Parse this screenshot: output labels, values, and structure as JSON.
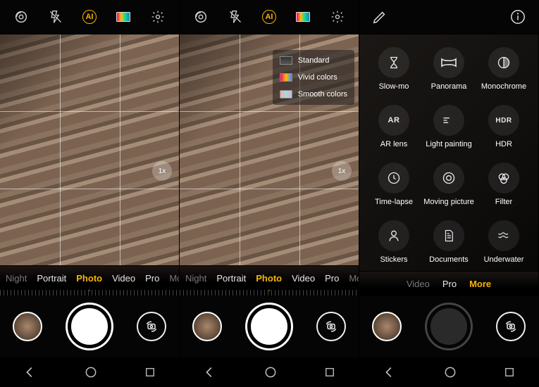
{
  "phone1": {
    "zoom": "1x",
    "modes": [
      "Night",
      "Portrait",
      "Photo",
      "Video",
      "Pro",
      "Mo"
    ],
    "active_mode": "Photo"
  },
  "phone2": {
    "zoom": "1x",
    "modes": [
      "Night",
      "Portrait",
      "Photo",
      "Video",
      "Pro",
      "Mo"
    ],
    "active_mode": "Photo",
    "filters": [
      {
        "label": "Standard",
        "swatch": "std"
      },
      {
        "label": "Vivid colors",
        "swatch": "viv"
      },
      {
        "label": "Smooth colors",
        "swatch": "smo"
      }
    ]
  },
  "phone3": {
    "modes_visible": [
      "Video",
      "Pro",
      "More"
    ],
    "active_mode": "More",
    "grid_modes": [
      {
        "label": "Slow-mo",
        "icon": "hourglass"
      },
      {
        "label": "Panorama",
        "icon": "panorama"
      },
      {
        "label": "Monochrome",
        "icon": "mono"
      },
      {
        "label": "AR lens",
        "icon": "ar"
      },
      {
        "label": "Light painting",
        "icon": "lightpaint"
      },
      {
        "label": "HDR",
        "icon": "hdr"
      },
      {
        "label": "Time-lapse",
        "icon": "timelapse"
      },
      {
        "label": "Moving picture",
        "icon": "moving"
      },
      {
        "label": "Filter",
        "icon": "filter"
      },
      {
        "label": "Stickers",
        "icon": "stickers"
      },
      {
        "label": "Documents",
        "icon": "documents"
      },
      {
        "label": "Underwater",
        "icon": "underwater"
      },
      {
        "label": "",
        "icon": "flower"
      },
      {
        "label": "",
        "icon": "download"
      }
    ]
  },
  "icon_svg": {
    "lens": "<svg width='22' height='22' viewBox='0 0 24 24' fill='none' stroke='currentColor' stroke-width='1.6'><circle cx='12' cy='12' r='8'/><circle cx='12' cy='12' r='3'/><path d='M5 12a7 7 0 0 1 7-7'/></svg>",
    "flash-off": "<svg width='20' height='20' viewBox='0 0 24 24' fill='none' stroke='currentColor' stroke-width='1.6'><path d='M7 2l-2 11h5l-1 9 8-13h-5l2-7z'/><line x1='3' y1='3' x2='21' y2='21'/></svg>",
    "gear": "<svg width='20' height='20' viewBox='0 0 24 24' fill='none' stroke='currentColor' stroke-width='1.6'><circle cx='12' cy='12' r='3'/><path d='M12 2v3M12 19v3M4.2 4.2l2.1 2.1M17.7 17.7l2.1 2.1M2 12h3M19 12h3M4.2 19.8l2.1-2.1M17.7 6.3l2.1-2.1'/></svg>",
    "edit": "<svg width='22' height='22' viewBox='0 0 24 24' fill='none' stroke='currentColor' stroke-width='1.6'><path d='M3 21l4-1 12-12-3-3L4 17z'/></svg>",
    "info": "<svg width='22' height='22' viewBox='0 0 24 24' fill='none' stroke='currentColor' stroke-width='1.6'><circle cx='12' cy='12' r='10'/><line x1='12' y1='10' x2='12' y2='17'/><circle cx='12' cy='7' r='0.5' fill='currentColor'/></svg>",
    "switch": "<svg width='20' height='20' viewBox='0 0 24 24' fill='none' stroke='currentColor' stroke-width='1.8'><rect x='6' y='8' width='12' height='8' rx='2'/><circle cx='12' cy='12' r='2'/><path d='M4 8a8 8 0 0 1 8-4M20 16a8 8 0 0 1-8 4'/></svg>",
    "back": "<svg width='22' height='22' viewBox='0 0 24 24' fill='none' stroke='currentColor' stroke-width='1.8'><path d='M14 5l-7 7 7 7'/></svg>",
    "home": "<svg width='20' height='20' viewBox='0 0 24 24' fill='none' stroke='currentColor' stroke-width='1.8'><circle cx='12' cy='12' r='8'/></svg>",
    "recent": "<svg width='18' height='18' viewBox='0 0 24 24' fill='none' stroke='currentColor' stroke-width='1.8'><rect x='5' y='5' width='14' height='14'/></svg>",
    "hourglass": "<svg width='20' height='20' viewBox='0 0 24 24' fill='none' stroke='currentColor' stroke-width='1.6'><path d='M6 3h12M6 21h12M7 3c0 5 5 5 5 9s-5 4-5 9M17 3c0 5-5 5-5 9s5 4 5 9'/></svg>",
    "panorama": "<svg width='24' height='16' viewBox='0 0 24 16' fill='none' stroke='currentColor' stroke-width='1.6'><path d='M2 3c4 3 16 3 20 0v10c-4-3-16-3-20 0z'/></svg>",
    "mono": "<svg width='20' height='20' viewBox='0 0 24 24' fill='none' stroke='currentColor' stroke-width='1.6'><circle cx='12' cy='12' r='9'/><path d='M12 3v18' /><path d='M12 3a9 9 0 0 1 0 18' fill='currentColor' opacity='0.4'/></svg>",
    "ar": "<span style='font-size:11px;font-weight:600;letter-spacing:0.5px'>AR</span>",
    "lightpaint": "<svg width='22' height='20' viewBox='0 0 24 24' fill='none' stroke='currentColor' stroke-width='1.6'><path d='M3 12h6M3 8h10M3 16h8'/></svg>",
    "hdr": "<span style='font-size:10px;font-weight:600;letter-spacing:0.5px'>HDR</span>",
    "timelapse": "<svg width='20' height='20' viewBox='0 0 24 24' fill='none' stroke='currentColor' stroke-width='1.6'><circle cx='12' cy='12' r='9'/><path d='M12 7v5l3 2'/></svg>",
    "moving": "<svg width='20' height='20' viewBox='0 0 24 24' fill='none' stroke='currentColor' stroke-width='1.6'><circle cx='12' cy='12' r='9'/><circle cx='12' cy='12' r='4'/></svg>",
    "filter": "<svg width='20' height='20' viewBox='0 0 24 24' fill='none' stroke='currentColor' stroke-width='1.6'><circle cx='9' cy='10' r='5'/><circle cx='15' cy='10' r='5'/><circle cx='12' cy='16' r='5'/></svg>",
    "stickers": "<svg width='20' height='20' viewBox='0 0 24 24' fill='none' stroke='currentColor' stroke-width='1.6'><circle cx='12' cy='8' r='4'/><path d='M5 21c0-4 3-7 7-7s7 3 7 7'/></svg>",
    "documents": "<svg width='18' height='20' viewBox='0 0 24 24' fill='none' stroke='currentColor' stroke-width='1.6'><path d='M6 2h9l4 4v16H6z'/><path d='M9 12h7M9 16h7M9 8h4'/></svg>",
    "underwater": "<svg width='22' height='18' viewBox='0 0 24 24' fill='none' stroke='currentColor' stroke-width='1.6'><path d='M2 8c2 2 4 2 6 0s4-2 6 0 4 2 6 0M2 14c2 2 4 2 6 0s4-2 6 0 4 2 6 0'/></svg>",
    "flower": "<svg width='20' height='20' viewBox='0 0 24 24' fill='none' stroke='currentColor' stroke-width='1.6'><circle cx='12' cy='12' r='3'/><path d='M12 3c2 0 3 3 3 5M12 21c-2 0-3-3-3-5M3 12c0-2 3-3 5-3M21 12c0 2-3 3-5 3M6 6c1.5-1.5 4 0 5 2M18 18c-1.5 1.5-4 0-5-2M18 6c1.5 1.5 0 4-2 5M6 18c-1.5-1.5 0-4 2-5'/></svg>",
    "download": "<svg width='20' height='20' viewBox='0 0 24 24' fill='none' stroke='currentColor' stroke-width='1.6'><path d='M12 4v11M7 11l5 5 5-5M5 20h14'/></svg>"
  }
}
